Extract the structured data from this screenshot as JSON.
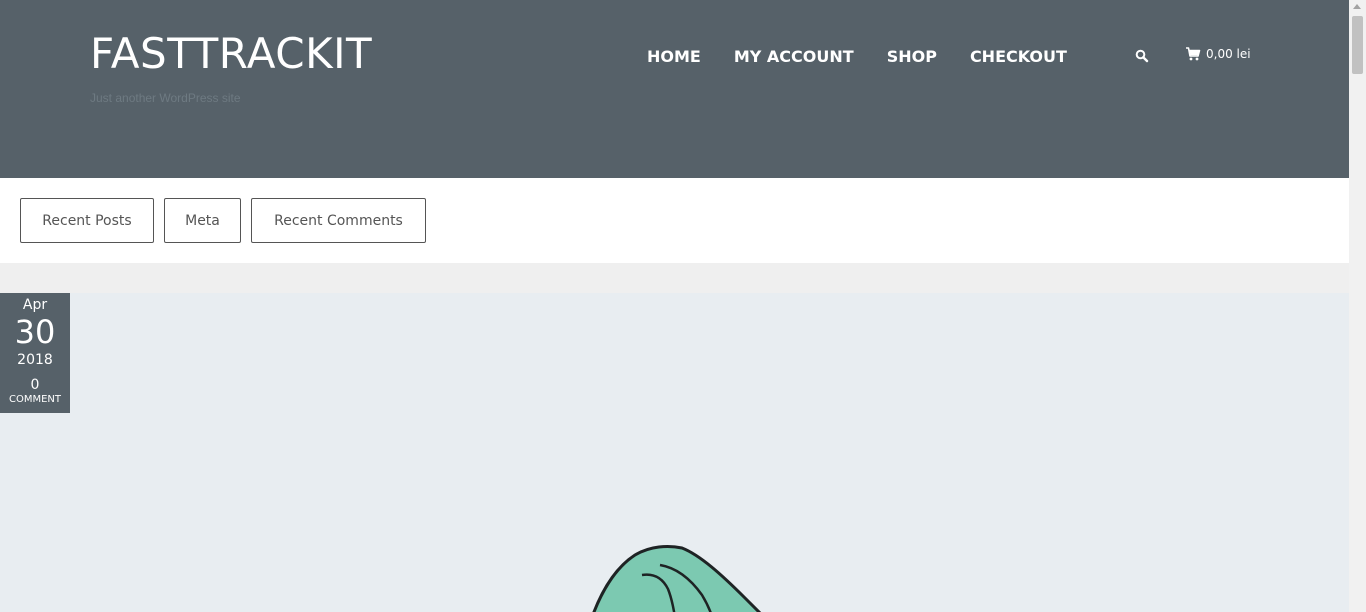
{
  "site": {
    "title": "FASTTRACKIT",
    "tagline": "Just another WordPress site"
  },
  "nav": {
    "items": [
      {
        "label": "HOME"
      },
      {
        "label": "MY ACCOUNT"
      },
      {
        "label": "SHOP"
      },
      {
        "label": "CHECKOUT"
      }
    ]
  },
  "header_icons": {
    "search_icon": "search-icon",
    "cart_icon": "cart-icon",
    "cart_total": "0,00 lei"
  },
  "tabs": [
    {
      "label": "Recent Posts"
    },
    {
      "label": "Meta"
    },
    {
      "label": "Recent Comments"
    }
  ],
  "post": {
    "date": {
      "month": "Apr",
      "day": "30",
      "year": "2018"
    },
    "comments": {
      "count": "0",
      "label": "COMMENT"
    }
  },
  "colors": {
    "header_bg": "#566169",
    "page_bg": "#efefef",
    "image_bg": "#e8edf1",
    "illustration_fill": "#7cc9b1"
  }
}
